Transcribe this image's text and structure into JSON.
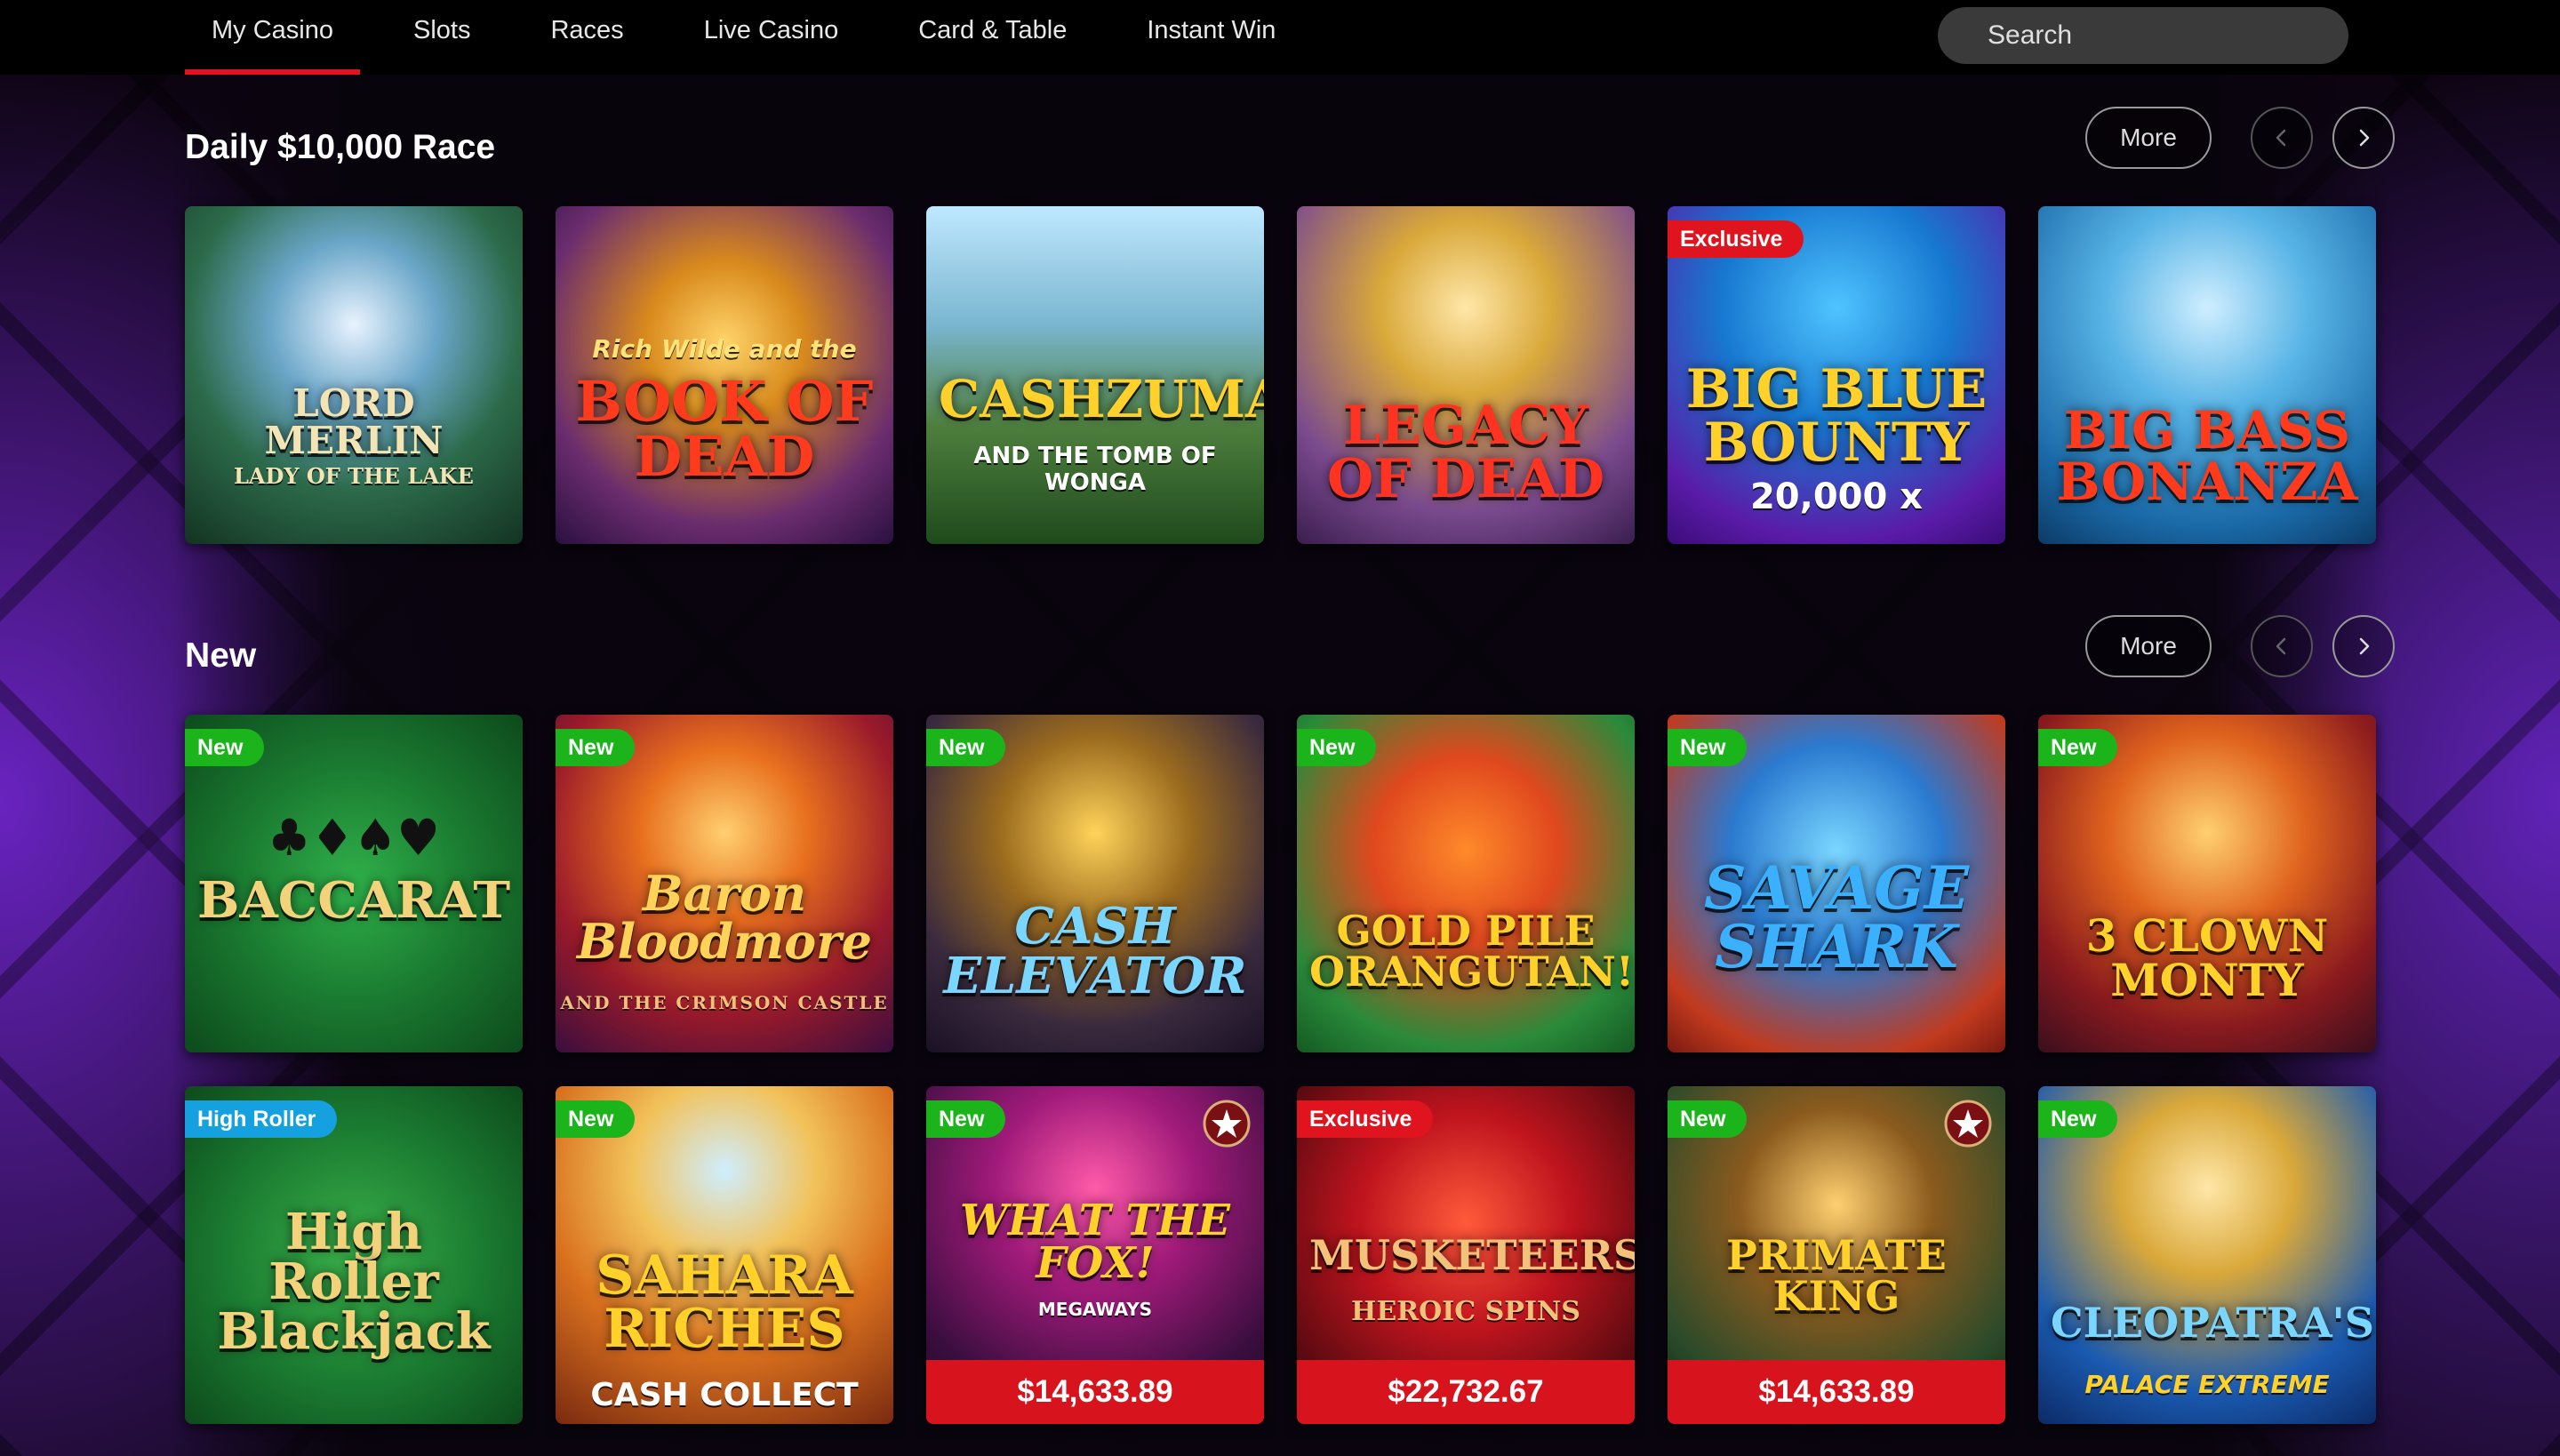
{
  "nav": {
    "items": [
      "My Casino",
      "Slots",
      "Races",
      "Live Casino",
      "Card & Table",
      "Instant Win"
    ],
    "active_index": 0
  },
  "search": {
    "placeholder": "Search"
  },
  "sections": [
    {
      "title": "Daily $10,000 Race",
      "more_label": "More",
      "tiles": [
        {
          "title": "LORD MERLIN",
          "subtitle": "LADY OF THE LAKE",
          "badge": null,
          "jackpot": null
        },
        {
          "title": "BOOK OF\nDEAD",
          "subtitle": "Rich Wilde and the",
          "badge": null,
          "jackpot": null
        },
        {
          "title": "CASHZUMA",
          "subtitle": "AND THE TOMB OF WONGA",
          "badge": null,
          "jackpot": null
        },
        {
          "title": "LEGACY\nOF DEAD",
          "subtitle": "",
          "badge": null,
          "jackpot": null
        },
        {
          "title": "BIG BLUE\nBOUNTY",
          "subtitle": "20,000 x",
          "badge": "Exclusive",
          "jackpot": null
        },
        {
          "title": "BIG BASS\nBONANZA",
          "subtitle": "",
          "badge": null,
          "jackpot": null
        }
      ]
    },
    {
      "title": "New",
      "more_label": "More",
      "tiles": [
        {
          "title": "BACCARAT",
          "subtitle": "♣♦♠♥",
          "badge": "New",
          "jackpot": null
        },
        {
          "title": "Baron\nBloodmore",
          "subtitle": "AND THE CRIMSON CASTLE",
          "badge": "New",
          "jackpot": null
        },
        {
          "title": "CASH\nELEVATOR",
          "subtitle": "",
          "badge": "New",
          "jackpot": null
        },
        {
          "title": "GOLD PILE\nORANGUTAN!",
          "subtitle": "",
          "badge": "New",
          "jackpot": null
        },
        {
          "title": "SAVAGE\nSHARK",
          "subtitle": "",
          "badge": "New",
          "jackpot": null
        },
        {
          "title": "3 CLOWN\nMONTY",
          "subtitle": "",
          "badge": "New",
          "jackpot": null
        },
        {
          "title": "High Roller\nBlackjack",
          "subtitle": "",
          "badge": "High Roller",
          "jackpot": null
        },
        {
          "title": "SAHARA\nRICHES",
          "subtitle": "CASH COLLECT",
          "badge": "New",
          "jackpot": null
        },
        {
          "title": "WHAT THE\nFOX!",
          "subtitle": "MEGAWAYS",
          "badge": "New",
          "jackpot": "$14,633.89"
        },
        {
          "title": "MUSKETEERS",
          "subtitle": "HEROIC SPINS",
          "badge": "Exclusive",
          "jackpot": "$22,732.67"
        },
        {
          "title": "PRIMATE KING",
          "subtitle": "",
          "badge": "New",
          "jackpot": "$14,633.89"
        },
        {
          "title": "CLEOPATRA'S",
          "subtitle": "PALACE EXTREME",
          "badge": "New",
          "jackpot": null
        }
      ]
    }
  ],
  "colors": {
    "accent": "#e0141e",
    "badge_new": "#1bb51b",
    "badge_exclusive": "#e0141e",
    "badge_high_roller": "#15a0e0"
  }
}
